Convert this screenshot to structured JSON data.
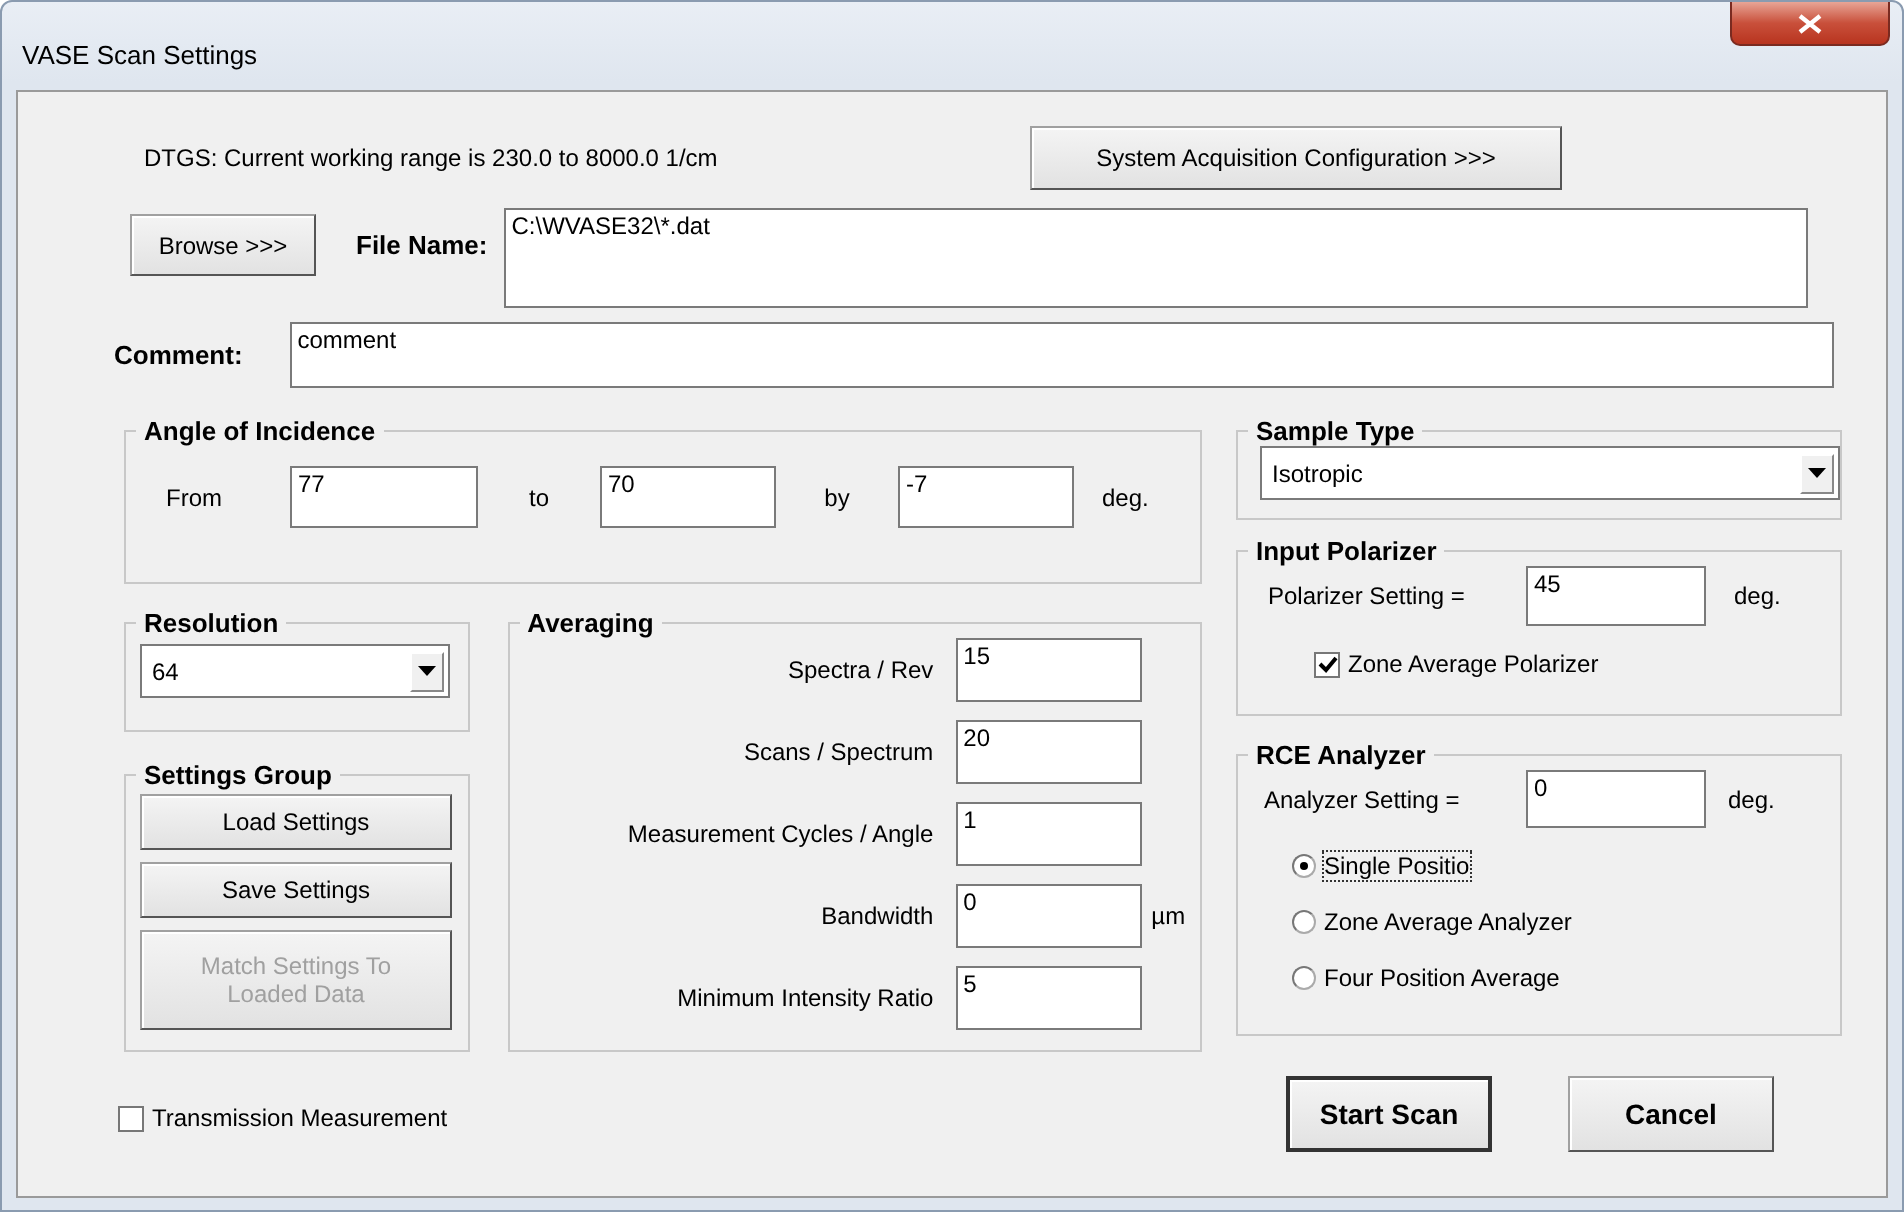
{
  "window": {
    "title": "VASE Scan Settings"
  },
  "detector_info": "DTGS:  Current working range is 230.0 to 8000.0 1/cm",
  "acquisition_button": "System Acquisition Configuration >>>",
  "browse_button": "Browse >>>",
  "file_name": {
    "label": "File Name:",
    "value": "C:\\WVASE32\\*.dat"
  },
  "comment": {
    "label": "Comment:",
    "value": "comment"
  },
  "angle_of_incidence": {
    "title": "Angle of Incidence",
    "unit": "deg.",
    "fields": [
      {
        "label": "From",
        "value": "77"
      },
      {
        "label": "to",
        "value": "70"
      },
      {
        "label": "by",
        "value": "-7"
      }
    ]
  },
  "resolution": {
    "title": "Resolution",
    "value": "64"
  },
  "settings_group": {
    "title": "Settings Group",
    "buttons": [
      {
        "label": "Load Settings",
        "disabled": false
      },
      {
        "label": "Save Settings",
        "disabled": false
      },
      {
        "label": "Match Settings To Loaded Data",
        "disabled": true
      }
    ]
  },
  "averaging": {
    "title": "Averaging",
    "fields": [
      {
        "label": "Spectra / Rev",
        "value": "15"
      },
      {
        "label": "Scans / Spectrum",
        "value": "20"
      },
      {
        "label": "Measurement Cycles / Angle",
        "value": "1"
      },
      {
        "label": "Bandwidth",
        "value": "0",
        "unit": "µm"
      },
      {
        "label": "Minimum Intensity Ratio",
        "value": "5"
      }
    ]
  },
  "transmission_measurement": {
    "label": "Transmission Measurement",
    "checked": false
  },
  "sample_type": {
    "title": "Sample Type",
    "value": "Isotropic"
  },
  "input_polarizer": {
    "title": "Input Polarizer",
    "setting_label": "Polarizer Setting =",
    "value": "45",
    "unit": "deg.",
    "zone_average": {
      "label": "Zone Average Polarizer",
      "checked": true
    }
  },
  "rce_analyzer": {
    "title": "RCE Analyzer",
    "setting_label": "Analyzer Setting =",
    "value": "0",
    "unit": "deg.",
    "modes": [
      {
        "label": "Single Positio",
        "selected": true
      },
      {
        "label": "Zone Average Analyzer",
        "selected": false
      },
      {
        "label": "Four Position Average",
        "selected": false
      }
    ]
  },
  "buttons": [
    {
      "label": "Start Scan",
      "default": true
    },
    {
      "label": "Cancel",
      "default": false
    }
  ]
}
